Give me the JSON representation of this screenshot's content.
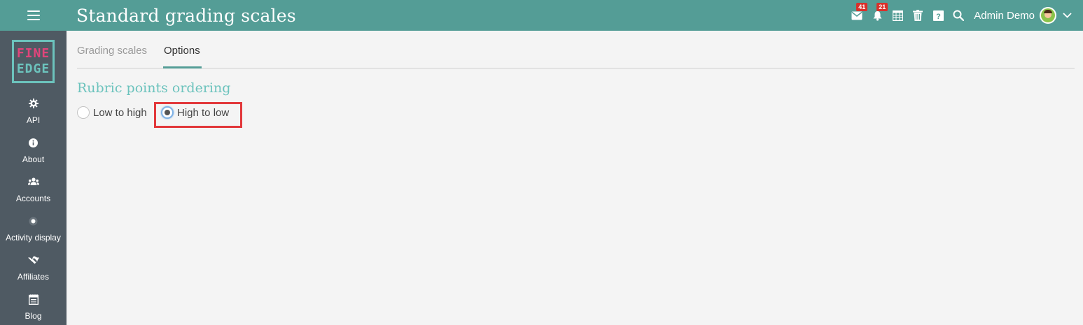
{
  "header": {
    "title": "Standard grading scales",
    "messages_badge": "41",
    "notifications_badge": "21",
    "user_name": "Admin Demo"
  },
  "logo": {
    "line1": "FINE",
    "line2": "EDGE"
  },
  "sidebar": {
    "items": [
      {
        "label": "API",
        "icon": "gear-icon"
      },
      {
        "label": "About",
        "icon": "info-icon"
      },
      {
        "label": "Accounts",
        "icon": "users-icon"
      },
      {
        "label": "Activity display",
        "icon": "circle-dot-icon"
      },
      {
        "label": "Affiliates",
        "icon": "handshake-icon"
      },
      {
        "label": "Blog",
        "icon": "blog-icon"
      }
    ]
  },
  "tabs": [
    {
      "label": "Grading scales",
      "active": false
    },
    {
      "label": "Options",
      "active": true
    }
  ],
  "section": {
    "title": "Rubric points ordering",
    "options": [
      {
        "label": "Low to high",
        "checked": false
      },
      {
        "label": "High to low",
        "checked": true
      }
    ]
  },
  "colors": {
    "topbar": "#549d96",
    "sidebar": "#4f5a63",
    "accent": "#6cc3bd",
    "highlight": "#e2383b",
    "badge": "#d9302a"
  }
}
